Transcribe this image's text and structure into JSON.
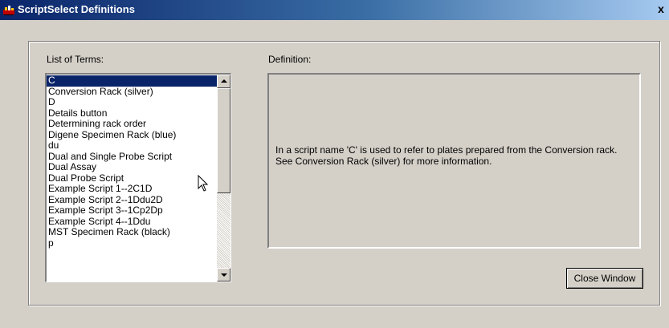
{
  "window": {
    "title": "ScriptSelect Definitions",
    "close_label": "x"
  },
  "terms": {
    "label": "List of Terms:",
    "selected_index": 0,
    "items": [
      "C",
      "Conversion Rack (silver)",
      "D",
      "Details button",
      "Determining rack order",
      "Digene Specimen Rack (blue)",
      "du",
      "Dual and Single Probe Script",
      "Dual Assay",
      "Dual Probe Script",
      "Example Script 1--2C1D",
      "Example Script 2--1Ddu2D",
      "Example Script 3--1Cp2Dp",
      "Example Script 4--1Ddu",
      "MST Specimen Rack (black)",
      "p"
    ]
  },
  "definition": {
    "label": "Definition:",
    "text": "In a script name 'C' is used to refer to plates prepared from the Conversion rack.   See Conversion Rack (silver) for more information."
  },
  "buttons": {
    "close_window": "Close Window"
  },
  "colors": {
    "face": "#d4d0c8",
    "selection": "#0a246a",
    "titlebar": "#0a246a"
  }
}
